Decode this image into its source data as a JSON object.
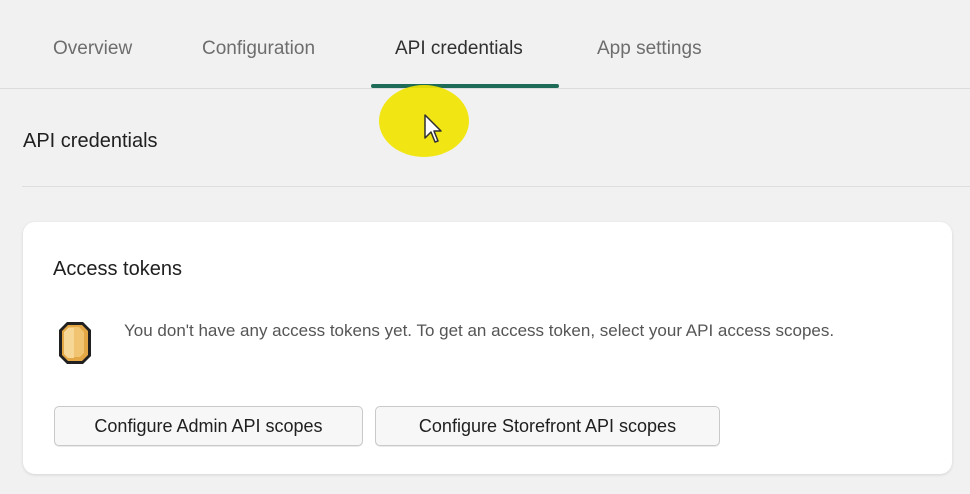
{
  "tabs": [
    {
      "label": "Overview",
      "active": false
    },
    {
      "label": "Configuration",
      "active": false
    },
    {
      "label": "API credentials",
      "active": true
    },
    {
      "label": "App settings",
      "active": false
    }
  ],
  "page": {
    "section_title": "API credentials"
  },
  "access_tokens": {
    "title": "Access tokens",
    "icon": "coin-icon",
    "notice": "You don't have any access tokens yet. To get an access token, select your API access scopes.",
    "buttons": {
      "admin_label": "Configure Admin API scopes",
      "storefront_label": "Configure Storefront API scopes"
    }
  },
  "colors": {
    "active_tab_underline": "#1e6b57",
    "cursor_highlight": "#f1e500",
    "coin": "#e3a845"
  }
}
